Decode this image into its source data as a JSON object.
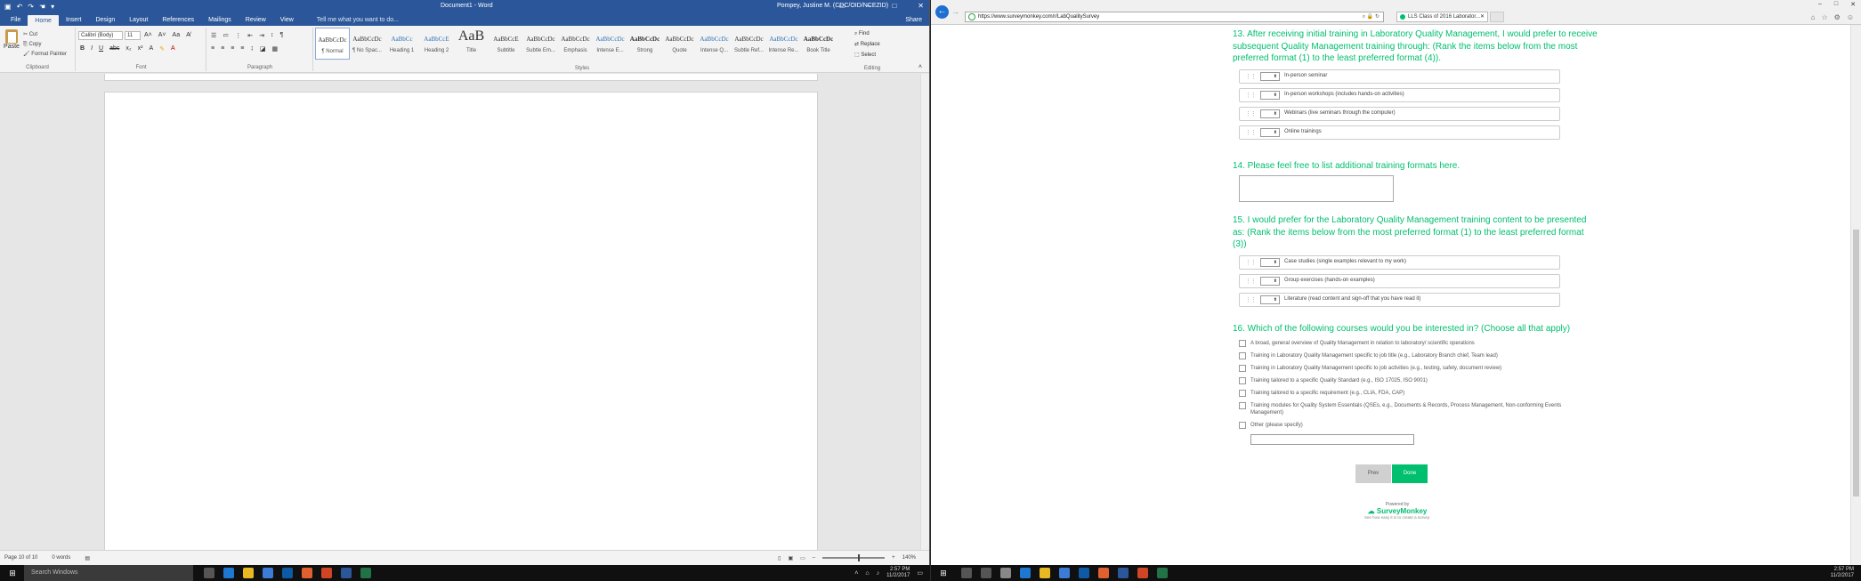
{
  "word": {
    "title": "Document1 - Word",
    "user": "Pompey, Justine M. (CDC/OID/NCEZID)",
    "tabs": [
      "File",
      "Home",
      "Insert",
      "Design",
      "Layout",
      "References",
      "Mailings",
      "Review",
      "View"
    ],
    "tell_me": "Tell me what you want to do...",
    "share": "Share",
    "clipboard": {
      "paste": "Paste",
      "cut": "Cut",
      "copy": "Copy",
      "format_painter": "Format Painter",
      "label": "Clipboard"
    },
    "font": {
      "family": "Calibri (Body)",
      "size": "11",
      "label": "Font"
    },
    "paragraph_label": "Paragraph",
    "styles_label": "Styles",
    "styles": [
      {
        "sample": "AaBbCcDc",
        "name": "¶ Normal"
      },
      {
        "sample": "AaBbCcDc",
        "name": "¶ No Spac..."
      },
      {
        "sample": "AaBbCc",
        "name": "Heading 1"
      },
      {
        "sample": "AaBbCcE",
        "name": "Heading 2"
      },
      {
        "sample": "AaB",
        "name": "Title"
      },
      {
        "sample": "AaBbCcE",
        "name": "Subtitle"
      },
      {
        "sample": "AaBbCcDc",
        "name": "Subtle Em..."
      },
      {
        "sample": "AaBbCcDc",
        "name": "Emphasis"
      },
      {
        "sample": "AaBbCcDc",
        "name": "Intense E..."
      },
      {
        "sample": "AaBbCcDc",
        "name": "Strong"
      },
      {
        "sample": "AaBbCcDc",
        "name": "Quote"
      },
      {
        "sample": "AaBbCcDc",
        "name": "Intense Q..."
      },
      {
        "sample": "AaBbCcDc",
        "name": "Subtle Ref..."
      },
      {
        "sample": "AaBbCcDc",
        "name": "Intense Re..."
      },
      {
        "sample": "AaBbCcDc",
        "name": "Book Title"
      }
    ],
    "editing": {
      "find": "Find",
      "replace": "Replace",
      "select": "Select",
      "label": "Editing"
    },
    "status": {
      "page": "Page 10 of 10",
      "words": "0 words",
      "zoom": "140%"
    }
  },
  "browser": {
    "url": "https://www.surveymonkey.com/r/LabQualitySurvey",
    "tab_title": "LLS Class of 2016 Laborator...",
    "survey": {
      "q13": {
        "title": "13. After receiving initial training in Laboratory Quality Management, I would prefer to receive subsequent Quality Management training through: (Rank the items below from the most preferred format (1) to the least preferred format (4)).",
        "items": [
          "In-person seminar",
          "In-person workshops (includes hands-on activities)",
          "Webinars (live seminars through the computer)",
          "Online trainings"
        ]
      },
      "q14": {
        "title": "14. Please feel free to list additional training formats here."
      },
      "q15": {
        "title": "15. I would prefer for the Laboratory Quality Management training content to be presented as: (Rank the items below from the most preferred format (1) to the least preferred format (3))",
        "items": [
          "Case studies (single examples relevant to my work)",
          "Group exercises (hands-on examples)",
          "Literature (read content and sign-off that you have read it)"
        ]
      },
      "q16": {
        "title": "16. Which of the following courses would you be interested in? (Choose all that apply)",
        "options": [
          "A broad, general overview of Quality Management in relation to laboratory/ scientific operations",
          "Training in Laboratory Quality Management specific to job title (e.g., Laboratory Branch chief, Team lead)",
          "Training in Laboratory Quality Management specific to job activities (e.g., testing, safety, document review)",
          "Training tailored to a specific Quality Standard (e.g., ISO 17025, ISO 9001)",
          "Training tailored to a specific requirement (e.g., CLIA, FDA, CAP)",
          "Training modules for Quality System Essentials (QSEs, e.g., Documents & Records, Process Management, Non-conforming Events Management)",
          "Other (please specify)"
        ]
      },
      "prev": "Prev",
      "done": "Done",
      "powered_by": "Powered by",
      "brand": "SurveyMonkey",
      "footer": "See how easy it is to create a survey."
    }
  },
  "taskbar": {
    "search": "Search Windows",
    "left_time": "2:57 PM",
    "left_date": "11/2/2017",
    "right_time": "2:57 PM",
    "right_date": "11/2/2017"
  }
}
